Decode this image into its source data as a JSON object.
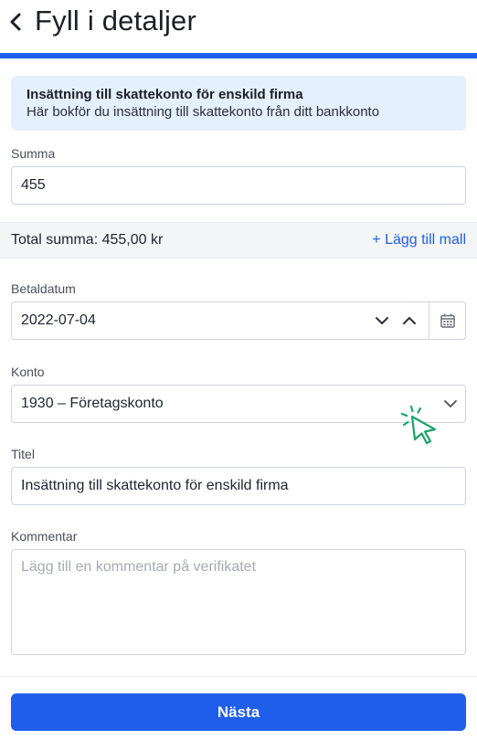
{
  "header": {
    "title": "Fyll i detaljer",
    "back_icon": "chevron-left-icon"
  },
  "banner": {
    "title": "Insättning till skattekonto för enskild firma",
    "text": "Här bokför du insättning till skattekonto från ditt bankkonto"
  },
  "summa": {
    "label": "Summa",
    "value": "455"
  },
  "total": {
    "text": "Total summa: 455,00 kr",
    "add_template": "+ Lägg till mall"
  },
  "betaldatum": {
    "label": "Betaldatum",
    "value": "2022-07-04",
    "icons": [
      "chevron-down-icon",
      "chevron-up-icon",
      "calendar-icon"
    ]
  },
  "konto": {
    "label": "Konto",
    "value": "1930 – Företagskonto",
    "icon": "chevron-down-icon"
  },
  "titel": {
    "label": "Titel",
    "value": "Insättning till skattekonto för enskild firma"
  },
  "kommentar": {
    "label": "Kommentar",
    "placeholder": "Lägg till en kommentar på verifikatet"
  },
  "footer": {
    "next_label": "Nästa"
  },
  "colors": {
    "accent": "#1e5eea",
    "banner_bg": "#e4f0fd",
    "cursor": "#1aa36b"
  }
}
